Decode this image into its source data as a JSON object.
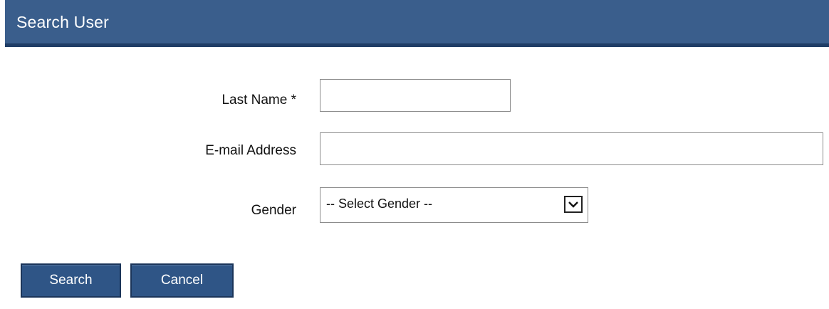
{
  "header": {
    "title": "Search User"
  },
  "form": {
    "last_name": {
      "label": "Last Name *",
      "value": "",
      "placeholder": ""
    },
    "email": {
      "label": "E-mail Address",
      "value": "",
      "placeholder": ""
    },
    "gender": {
      "label": "Gender",
      "selected": "-- Select Gender --"
    }
  },
  "actions": {
    "search_label": "Search",
    "cancel_label": "Cancel"
  },
  "colors": {
    "header_bg": "#3a5e8c",
    "button_bg": "#2f5586"
  },
  "icons": {
    "select_arrow": "chevron-down-icon"
  }
}
